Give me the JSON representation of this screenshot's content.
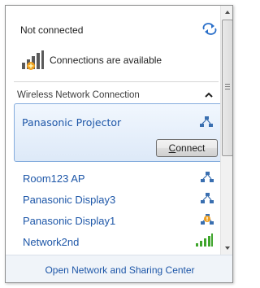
{
  "status": {
    "title": "Not connected",
    "availability": "Connections are available"
  },
  "section": {
    "title": "Wireless Network Connection"
  },
  "selected_network": {
    "name": "Panasonic Projector",
    "connect_label_underlined": "C",
    "connect_label_rest": "onnect"
  },
  "networks": [
    {
      "name": "Room123 AP",
      "signal_icon": "adhoc-network-icon"
    },
    {
      "name": "Panasonic Display3",
      "signal_icon": "adhoc-network-icon"
    },
    {
      "name": "Panasonic Display1",
      "signal_icon": "adhoc-network-warning-icon"
    },
    {
      "name": "Network2nd",
      "signal_icon": "wifi-signal-bars-icon"
    }
  ],
  "footer": {
    "link": "Open Network and Sharing Center"
  },
  "colors": {
    "link": "#1e57a8",
    "selection_border": "#84acdd",
    "signal_green": "#3fa52c",
    "warning_orange": "#f0a020"
  }
}
